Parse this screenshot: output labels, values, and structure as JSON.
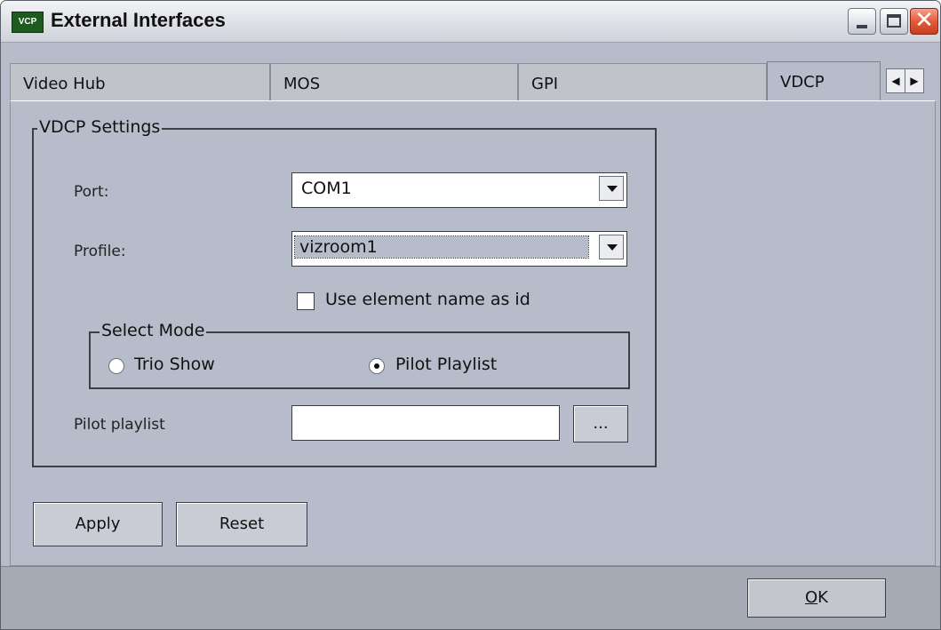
{
  "window": {
    "title": "External Interfaces",
    "app_icon_text": "VCP",
    "controls": {
      "minimize": "minimize-icon",
      "maximize": "maximize-icon",
      "close": "close-icon"
    }
  },
  "tabs": [
    {
      "label": "Video Hub",
      "active": false
    },
    {
      "label": "MOS",
      "active": false
    },
    {
      "label": "GPI",
      "active": false
    },
    {
      "label": "VDCP",
      "active": true
    }
  ],
  "tab_scroll": {
    "left_icon": "arrow-left-icon",
    "right_icon": "arrow-right-icon"
  },
  "vdcp": {
    "group_title": "VDCP Settings",
    "port": {
      "label": "Port:",
      "value": "COM1"
    },
    "profile": {
      "label": "Profile:",
      "value": "vizroom1"
    },
    "use_element_name": {
      "label": "Use element name as id",
      "checked": false
    },
    "select_mode": {
      "title": "Select Mode",
      "options": [
        {
          "label": "Trio Show",
          "selected": false
        },
        {
          "label": "Pilot Playlist",
          "selected": true
        }
      ]
    },
    "pilot_playlist": {
      "label": "Pilot playlist",
      "value": "",
      "browse_label": "..."
    }
  },
  "actions": {
    "apply": "Apply",
    "reset": "Reset"
  },
  "footer": {
    "ok_letter": "O",
    "ok_rest": "K"
  },
  "colors": {
    "background": "#b7bccb",
    "close_button": "#e35a3a",
    "app_icon": "#1d5b1f"
  }
}
